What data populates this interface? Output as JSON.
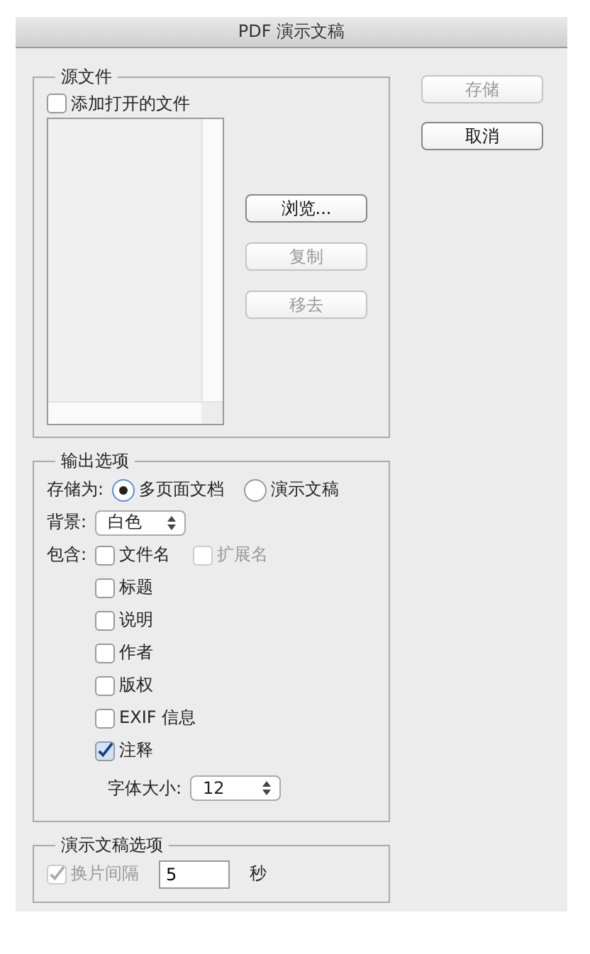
{
  "window": {
    "title": "PDF 演示文稿"
  },
  "source": {
    "legend": "源文件",
    "add_open": {
      "label": "添加打开的文件",
      "checked": false,
      "disabled": false
    },
    "buttons": [
      {
        "label": "浏览...",
        "disabled": false
      },
      {
        "label": "复制",
        "disabled": true
      },
      {
        "label": "移去",
        "disabled": true
      }
    ]
  },
  "output": {
    "legend": "输出选项",
    "save_as_label": "存储为:",
    "save_as": [
      {
        "label": "多页面文档",
        "selected": true
      },
      {
        "label": "演示文稿",
        "selected": false
      }
    ],
    "background_label": "背景:",
    "background": "白色",
    "include_label": "包含:",
    "include": [
      {
        "label": "文件名",
        "checked": false,
        "disabled": false
      },
      {
        "label": "标题",
        "checked": false,
        "disabled": false
      },
      {
        "label": "说明",
        "checked": false,
        "disabled": false
      },
      {
        "label": "作者",
        "checked": false,
        "disabled": false
      },
      {
        "label": "版权",
        "checked": false,
        "disabled": false
      },
      {
        "label": "EXIF 信息",
        "checked": false,
        "disabled": false
      },
      {
        "label": "注释",
        "checked": true,
        "disabled": false
      }
    ],
    "extension": {
      "label": "扩展名",
      "checked": false,
      "disabled": true
    },
    "font_size_label": "字体大小:",
    "font_size": "12"
  },
  "presentation": {
    "legend": "演示文稿选项",
    "advance": {
      "label": "换片间隔",
      "checked": true,
      "disabled": true
    },
    "interval": "5",
    "unit": "秒"
  },
  "actions": [
    {
      "label": "存储",
      "disabled": true
    },
    {
      "label": "取消",
      "disabled": false
    }
  ]
}
